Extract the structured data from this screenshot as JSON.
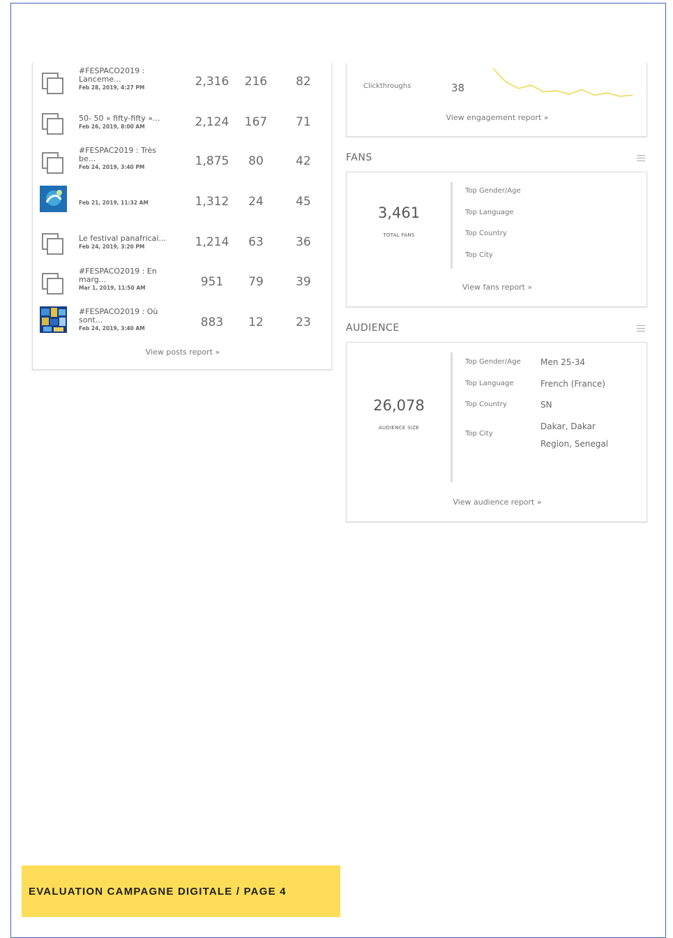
{
  "posts": {
    "rows": [
      {
        "title": "#FESPACO2019 :\nLanceme...",
        "date": "Feb 28, 2019, 4:27 PM",
        "thumb": "multi-image-icon",
        "v1": "2,316",
        "v2": "216",
        "v3": "82"
      },
      {
        "title": "50- 50 » fifty-fifty »...",
        "date": "Feb 26, 2019, 8:00 AM",
        "thumb": "multi-image-icon",
        "v1": "2,124",
        "v2": "167",
        "v3": "71"
      },
      {
        "title": "#FESPAC2019 : Très\nbe...",
        "date": "Feb 24, 2019, 3:40 PM",
        "thumb": "multi-image-icon",
        "v1": "1,875",
        "v2": "80",
        "v3": "42"
      },
      {
        "title": "",
        "date": "Feb 21, 2019, 11:32 AM",
        "thumb": "photo-thumbnail-blue",
        "v1": "1,312",
        "v2": "24",
        "v3": "45"
      },
      {
        "title": "Le festival panafricai...",
        "date": "Feb 24, 2019, 3:20 PM",
        "thumb": "multi-image-icon",
        "v1": "1,214",
        "v2": "63",
        "v3": "36"
      },
      {
        "title": "#FESPACO2019 : En\nmarg...",
        "date": "Mar 1, 2019, 11:50 AM",
        "thumb": "multi-image-icon",
        "v1": "951",
        "v2": "79",
        "v3": "39"
      },
      {
        "title": "#FESPACO2019 : Où\nsont...",
        "date": "Feb 24, 2019, 3:40 AM",
        "thumb": "photo-thumbnail-mosaic",
        "v1": "883",
        "v2": "12",
        "v3": "23"
      }
    ],
    "view_link": "View posts report »"
  },
  "engagement": {
    "clickthroughs_label": "Clickthroughs",
    "clickthroughs_value": "38",
    "sparkline_color": "#f2d64b",
    "sparkline": [
      30,
      18,
      12,
      15,
      9,
      10,
      7,
      11,
      6,
      8,
      5,
      6
    ],
    "view_link": "View engagement report »"
  },
  "fans": {
    "title": "FANS",
    "total": "3,461",
    "total_label": "TOTAL FANS",
    "labels": [
      "Top Gender/Age",
      "Top Language",
      "Top Country",
      "Top City"
    ],
    "view_link": "View fans report »"
  },
  "audience": {
    "title": "AUDIENCE",
    "size": "26,078",
    "size_label": "AUDIENCE SIZE",
    "rows": [
      {
        "label": "Top Gender/Age",
        "value": "Men 25-34"
      },
      {
        "label": "Top Language",
        "value": "French (France)"
      },
      {
        "label": "Top Country",
        "value": "SN"
      },
      {
        "label": "Top City",
        "value": "Dakar, Dakar\nRegion, Senegal"
      }
    ],
    "view_link": "View audience report »"
  },
  "footer": {
    "text": "EVALUATION CAMPAGNE DIGITALE / PAGE 4",
    "color": "#fddc58"
  },
  "frame_color": "#3e63b8"
}
